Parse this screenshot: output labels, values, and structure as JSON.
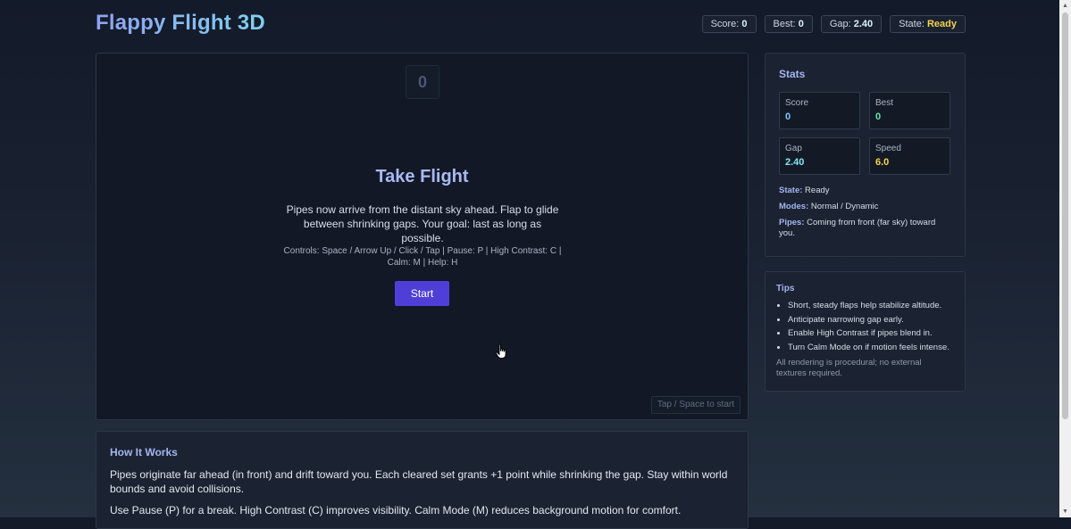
{
  "header": {
    "title": "Flappy Flight 3D",
    "hud": [
      {
        "label": "Score:",
        "value": "0"
      },
      {
        "label": "Best:",
        "value": "0"
      },
      {
        "label": "Gap:",
        "value": "2.40"
      },
      {
        "label": "State:",
        "value": "Ready"
      }
    ]
  },
  "game": {
    "score": "0",
    "overlay": {
      "title": "Take Flight",
      "description": "Pipes now arrive from the distant sky ahead. Flap to glide between shrinking gaps. Your goal: last as long as possible.",
      "controls": "Controls: Space / Arrow Up / Click / Tap | Pause: P | High Contrast: C | Calm: M | Help: H",
      "start_label": "Start"
    },
    "hint": "Tap / Space to start"
  },
  "how": {
    "title": "How It Works",
    "p1": "Pipes originate far ahead (in front) and drift toward you. Each cleared set grants +1 point while shrinking the gap. Stay within world bounds and avoid collisions.",
    "p2": "Use Pause (P) for a break. High Contrast (C) improves visibility. Calm Mode (M) reduces background motion for comfort."
  },
  "stats": {
    "title": "Stats",
    "tiles": [
      {
        "label": "Score",
        "value": "0"
      },
      {
        "label": "Best",
        "value": "0"
      },
      {
        "label": "Gap",
        "value": "2.40"
      },
      {
        "label": "Speed",
        "value": "6.0"
      }
    ],
    "state_label": "State:",
    "state_value": "Ready",
    "modes_label": "Modes:",
    "modes_value": "Normal / Dynamic",
    "pipes_label": "Pipes:",
    "pipes_value": "Coming from front (far sky) toward you."
  },
  "tips": {
    "title": "Tips",
    "items": [
      "Short, steady flaps help stabilize altitude.",
      "Anticipate narrowing gap early.",
      "Enable High Contrast if pipes blend in.",
      "Turn Calm Mode on if motion feels intense."
    ],
    "note": "All rendering is procedural; no external textures required."
  },
  "colors": {
    "accent": "#4f3fd8",
    "state_ready": "#f2d44a",
    "best": "#63e8a5",
    "panel": "#1b2332"
  },
  "icons": [
    "cursor-icon",
    "scroll-up-icon",
    "scroll-down-icon"
  ]
}
